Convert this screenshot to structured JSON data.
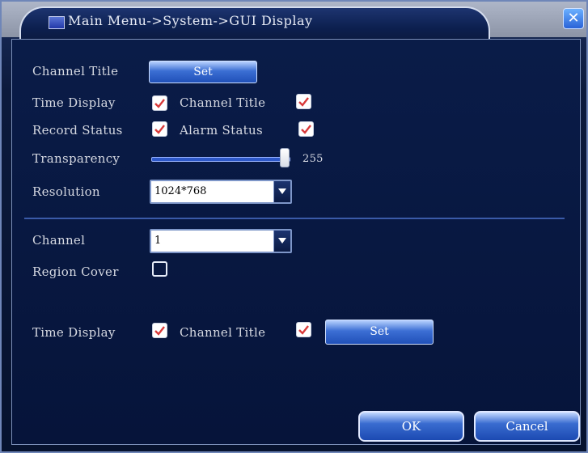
{
  "window": {
    "breadcrumb": "Main Menu->System->GUI Display",
    "close_symbol": "✕"
  },
  "global": {
    "channel_title_label": "Channel Title",
    "set_label": "Set",
    "time_display_label": "Time Display",
    "time_display_checked": true,
    "channel_title_checkbox_label": "Channel Title",
    "channel_title_checked": true,
    "record_status_label": "Record Status",
    "record_status_checked": true,
    "alarm_status_label": "Alarm Status",
    "alarm_status_checked": true,
    "transparency_label": "Transparency",
    "transparency_value": "255",
    "transparency_max": 255,
    "resolution_label": "Resolution",
    "resolution_value": "1024*768"
  },
  "channel": {
    "channel_label": "Channel",
    "channel_value": "1",
    "region_cover_label": "Region Cover",
    "region_cover_checked": false,
    "time_display_label": "Time Display",
    "time_display_checked": true,
    "channel_title_label": "Channel Title",
    "channel_title_checked": true,
    "set_label": "Set"
  },
  "footer": {
    "ok_label": "OK",
    "cancel_label": "Cancel"
  },
  "colors": {
    "check_mark": "#d83a3a",
    "button_blue": "#2050b8",
    "panel_bg": "#06143a"
  },
  "icons": {
    "title_icon": "monitor-icon",
    "close_icon": "close-icon",
    "check": "checkmark-icon",
    "dropdown": "chevron-down-icon"
  }
}
